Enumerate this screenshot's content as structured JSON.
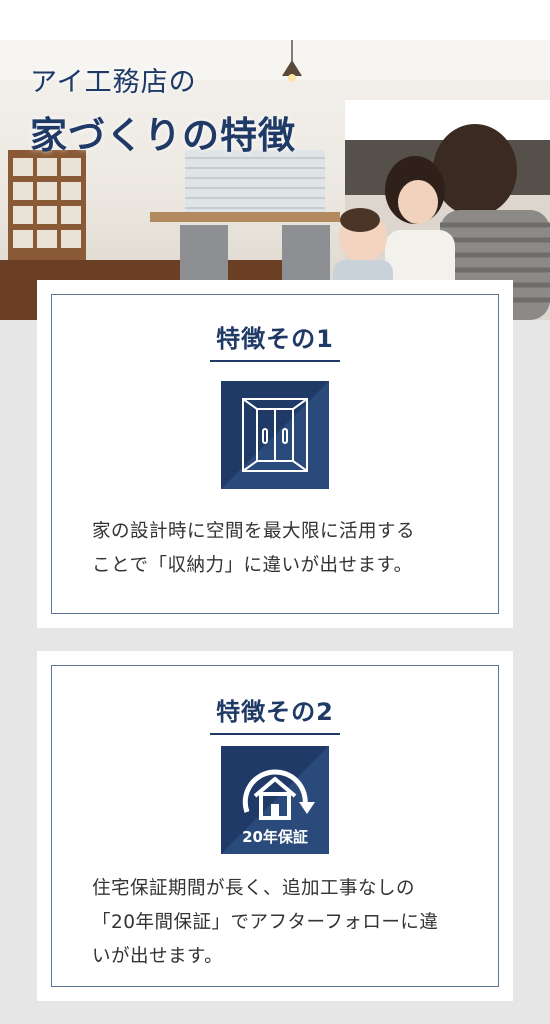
{
  "hero": {
    "title_line1": "アイ工務店の",
    "title_line2": "家づくりの特徴"
  },
  "features": [
    {
      "heading": "特徴その1",
      "icon": "closet-door-icon",
      "text_line1": "家の設計時に空間を最大限に活用する",
      "text_line2": "ことで「収納力」に違いが出せます。"
    },
    {
      "heading": "特徴その2",
      "icon": "house-warranty-icon",
      "badge": "20年保証",
      "text_line1": "住宅保証期間が長く、追加工事なしの",
      "text_line2": "「20年間保証」でアフターフォローに違",
      "text_line3": "いが出せます。"
    }
  ],
  "colors": {
    "navy": "#1f3a66",
    "frame": "#5f7794",
    "background": "#e6e6e6"
  }
}
